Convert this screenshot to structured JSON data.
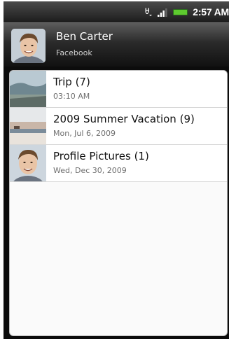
{
  "status_bar": {
    "network": "H",
    "time": "2:57 AM"
  },
  "header": {
    "name": "Ben Carter",
    "source": "Facebook"
  },
  "albums": [
    {
      "title": "Trip (7)",
      "date": "03:10 AM"
    },
    {
      "title": "2009 Summer Vacation (9)",
      "date": "Mon, Jul 6, 2009"
    },
    {
      "title": "Profile Pictures (1)",
      "date": "Wed, Dec 30, 2009"
    }
  ]
}
